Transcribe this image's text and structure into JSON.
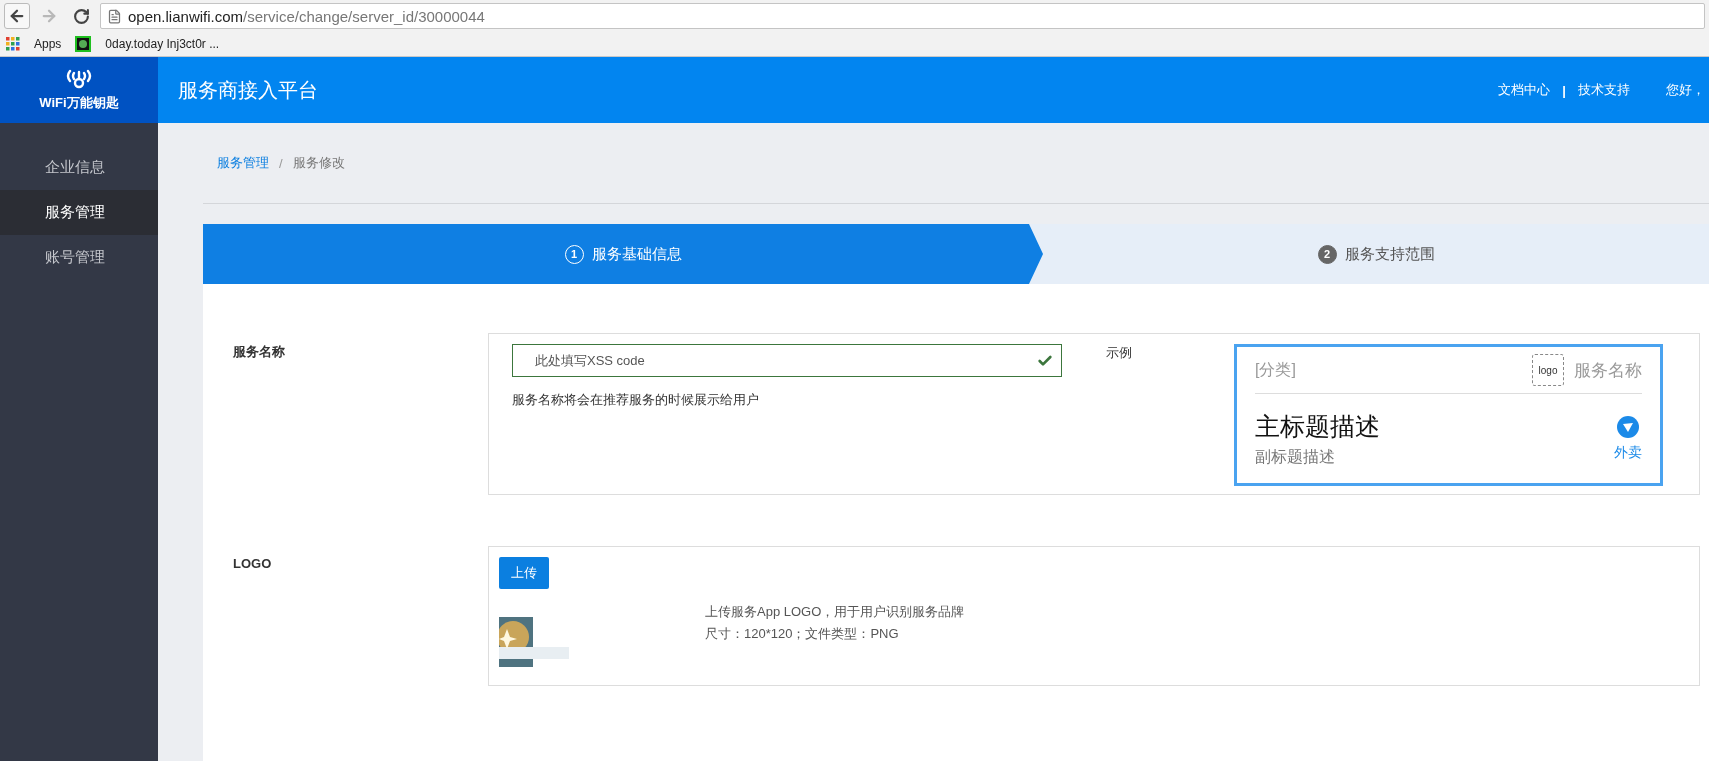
{
  "browser": {
    "url_host": "open.lianwifi.com",
    "url_path": "/service/change/server_id/30000044",
    "forward_disabled": true,
    "bookmarks": [
      {
        "label": "Apps",
        "kind": "apps"
      },
      {
        "label": "0day.today Inj3ct0r ...",
        "kind": "site"
      }
    ]
  },
  "header": {
    "brand": "WiFi万能钥匙",
    "title": "服务商接入平台",
    "links": [
      "文档中心",
      "技术支持"
    ],
    "separator": "|",
    "greeting": "您好，"
  },
  "sidebar": {
    "items": [
      {
        "label": "企业信息",
        "selected": false
      },
      {
        "label": "服务管理",
        "selected": true
      },
      {
        "label": "账号管理",
        "selected": false
      }
    ]
  },
  "breadcrumb": {
    "separator": "/",
    "items": [
      {
        "label": "服务管理",
        "kind": "link"
      },
      {
        "label": "服务修改",
        "kind": "current"
      }
    ]
  },
  "steps": [
    {
      "number": "1",
      "label": "服务基础信息",
      "selected": true
    },
    {
      "number": "2",
      "label": "服务支持范围",
      "selected": false
    }
  ],
  "form": {
    "name_field": {
      "label": "服务名称",
      "value": "此处填写XSS code",
      "valid": true,
      "help": "服务名称将会在推荐服务的时候展示给用户",
      "example_label": "示例",
      "example": {
        "category": "[分类]",
        "logo": "logo",
        "service_name": "服务名称",
        "title": "主标题描述",
        "subtitle": "副标题描述",
        "tag": "外卖"
      }
    },
    "logo_field": {
      "label": "LOGO",
      "button": "上传",
      "description": "上传服务App LOGO，用于用户识别服务品牌",
      "spec": "尺寸：120*120；文件类型：PNG"
    }
  }
}
